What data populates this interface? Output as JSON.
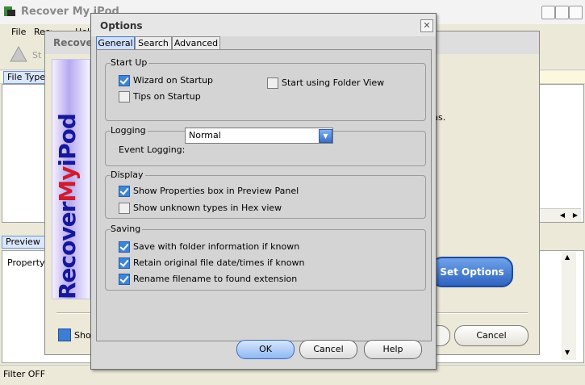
{
  "main": {
    "title": "Recover My iPod",
    "menu": [
      "File",
      "Recover",
      "Help"
    ],
    "toolbar_start": "Start",
    "file_type_tab": "File Type",
    "preview_tab": "Preview",
    "property_label": "Property",
    "status": "Filter OFF"
  },
  "wizard": {
    "title": "Recover My iPod",
    "banner": {
      "left": "Recover",
      "my": "My",
      "right": "iPod"
    },
    "body_text": "ns.",
    "set_options": "Set Options",
    "show_label": "Show",
    "cancel": "Cancel"
  },
  "options": {
    "title": "Options",
    "close": "✕",
    "tabs": [
      "General",
      "Search",
      "Advanced"
    ],
    "startup": {
      "title": "Start Up",
      "wizard_on_startup": {
        "label": "Wizard on Startup",
        "checked": true
      },
      "tips_on_startup": {
        "label": "Tips on Startup",
        "checked": false
      },
      "start_using_folder_view": {
        "label": "Start using Folder View",
        "checked": false
      }
    },
    "logging": {
      "title": "Logging",
      "event_logging_label": "Event Logging:",
      "event_logging_value": "Normal"
    },
    "display": {
      "title": "Display",
      "show_properties": {
        "label": "Show Properties box in Preview Panel",
        "checked": true
      },
      "show_unknown_hex": {
        "label": "Show unknown types in Hex view",
        "checked": false
      }
    },
    "saving": {
      "title": "Saving",
      "save_folder_info": {
        "label": "Save with folder information if known",
        "checked": true
      },
      "retain_dates": {
        "label": "Retain original file date/times if known",
        "checked": true
      },
      "rename_extension": {
        "label": "Rename filename to found extension",
        "checked": true
      }
    },
    "buttons": {
      "ok": "OK",
      "cancel": "Cancel",
      "help": "Help"
    }
  }
}
